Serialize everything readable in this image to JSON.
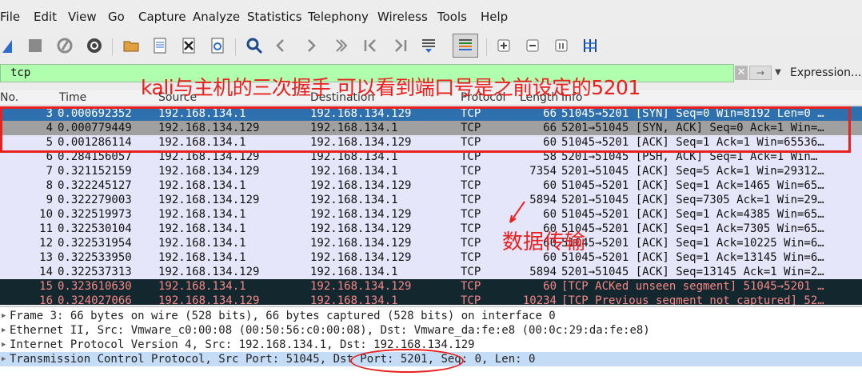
{
  "menu": [
    "File",
    "Edit",
    "View",
    "Go",
    "Capture",
    "Analyze",
    "Statistics",
    "Telephony",
    "Wireless",
    "Tools",
    "Help"
  ],
  "toolbar_icons": [
    "shark-fin-icon",
    "stop-icon",
    "restart-icon",
    "gear-icon",
    "open-folder-icon",
    "save-file-icon",
    "close-file-icon",
    "reload-icon",
    "search-icon",
    "go-back-icon",
    "go-forward-icon",
    "go-to-packet-icon",
    "first-packet-icon",
    "last-packet-icon",
    "autoscroll-icon",
    "colorize-icon",
    "zoom-in-icon",
    "zoom-out-icon",
    "normal-size-icon",
    "resize-columns-icon"
  ],
  "filter": {
    "value": "tcp",
    "expression_label": "Expression..."
  },
  "columns": [
    "No.",
    "Time",
    "Source",
    "Destination",
    "Protocol",
    "Length",
    "Info"
  ],
  "packets": [
    {
      "no": "3",
      "time": "0.000692352",
      "src": "192.168.134.1",
      "dst": "192.168.134.129",
      "proto": "TCP",
      "len": "66",
      "info": "51045→5201 [SYN] Seq=0 Win=8192 Len=0 …",
      "bg": "#2e6fad",
      "fg": "#ffffff"
    },
    {
      "no": "4",
      "time": "0.000779449",
      "src": "192.168.134.129",
      "dst": "192.168.134.1",
      "proto": "TCP",
      "len": "66",
      "info": "5201→51045 [SYN, ACK] Seq=0 Ack=1 Win=…",
      "bg": "#a0a0a0",
      "fg": "#111111"
    },
    {
      "no": "5",
      "time": "0.001286114",
      "src": "192.168.134.1",
      "dst": "192.168.134.129",
      "proto": "TCP",
      "len": "60",
      "info": "51045→5201 [ACK] Seq=1 Ack=1 Win=65536…",
      "bg": "#e6e6fa",
      "fg": "#111111"
    },
    {
      "no": "6",
      "time": "0.284156057",
      "src": "192.168.134.129",
      "dst": "192.168.134.1",
      "proto": "TCP",
      "len": "58",
      "info": "5201→51045 [PSH, ACK] Seq=1 Ack=1 Win…",
      "bg": "#e6e6fa",
      "fg": "#111111"
    },
    {
      "no": "7",
      "time": "0.321152159",
      "src": "192.168.134.129",
      "dst": "192.168.134.1",
      "proto": "TCP",
      "len": "7354",
      "info": "5201→51045 [ACK] Seq=5 Ack=1 Win=29312…",
      "bg": "#e6e6fa",
      "fg": "#111111"
    },
    {
      "no": "8",
      "time": "0.322245127",
      "src": "192.168.134.1",
      "dst": "192.168.134.129",
      "proto": "TCP",
      "len": "60",
      "info": "51045→5201 [ACK] Seq=1 Ack=1465 Win=65…",
      "bg": "#e6e6fa",
      "fg": "#111111"
    },
    {
      "no": "9",
      "time": "0.322279003",
      "src": "192.168.134.129",
      "dst": "192.168.134.1",
      "proto": "TCP",
      "len": "5894",
      "info": "5201→51045 [ACK] Seq=7305 Ack=1 Win=29…",
      "bg": "#e6e6fa",
      "fg": "#111111"
    },
    {
      "no": "10",
      "time": "0.322519973",
      "src": "192.168.134.1",
      "dst": "192.168.134.129",
      "proto": "TCP",
      "len": "60",
      "info": "51045→5201 [ACK] Seq=1 Ack=4385 Win=65…",
      "bg": "#e6e6fa",
      "fg": "#111111"
    },
    {
      "no": "11",
      "time": "0.322530104",
      "src": "192.168.134.1",
      "dst": "192.168.134.129",
      "proto": "TCP",
      "len": "60",
      "info": "51045→5201 [ACK] Seq=1 Ack=7305 Win=65…",
      "bg": "#e6e6fa",
      "fg": "#111111"
    },
    {
      "no": "12",
      "time": "0.322531954",
      "src": "192.168.134.1",
      "dst": "192.168.134.129",
      "proto": "TCP",
      "len": "60",
      "info": "51045→5201 [ACK] Seq=1 Ack=10225 Win=6…",
      "bg": "#e6e6fa",
      "fg": "#111111"
    },
    {
      "no": "13",
      "time": "0.322533950",
      "src": "192.168.134.1",
      "dst": "192.168.134.129",
      "proto": "TCP",
      "len": "60",
      "info": "51045→5201 [ACK] Seq=1 Ack=13145 Win=6…",
      "bg": "#e6e6fa",
      "fg": "#111111"
    },
    {
      "no": "14",
      "time": "0.322537313",
      "src": "192.168.134.129",
      "dst": "192.168.134.1",
      "proto": "TCP",
      "len": "5894",
      "info": "5201→51045 [ACK] Seq=13145 Ack=1 Win=2…",
      "bg": "#e6e6fa",
      "fg": "#111111"
    },
    {
      "no": "15",
      "time": "0.323610630",
      "src": "192.168.134.1",
      "dst": "192.168.134.129",
      "proto": "TCP",
      "len": "60",
      "info": "[TCP ACKed unseen segment] 51045→5201 …",
      "bg": "#12272e",
      "fg": "#f78787"
    },
    {
      "no": "16",
      "time": "0.324027066",
      "src": "192.168.134.129",
      "dst": "192.168.134.1",
      "proto": "TCP",
      "len": "10234",
      "info": "[TCP Previous segment not captured] 52…",
      "bg": "#12272e",
      "fg": "#f78787"
    }
  ],
  "details": [
    {
      "text": "Frame 3: 66 bytes on wire (528 bits), 66 bytes captured (528 bits) on interface 0",
      "selected": false
    },
    {
      "text": "Ethernet II, Src: Vmware_c0:00:08 (00:50:56:c0:00:08), Dst: Vmware_da:fe:e8 (00:0c:29:da:fe:e8)",
      "selected": false
    },
    {
      "text": "Internet Protocol Version 4, Src: 192.168.134.1, Dst: 192.168.134.129",
      "selected": false
    },
    {
      "text": "Transmission Control Protocol, Src Port: 51045, Dst Port: 5201, Seq: 0, Len: 0",
      "selected": true
    }
  ],
  "annotations": {
    "handshake_caption": "kali与主机的三次握手 可以看到端口号是之前设定的5201",
    "data_caption": "数据传输",
    "color": "#e8201e"
  }
}
